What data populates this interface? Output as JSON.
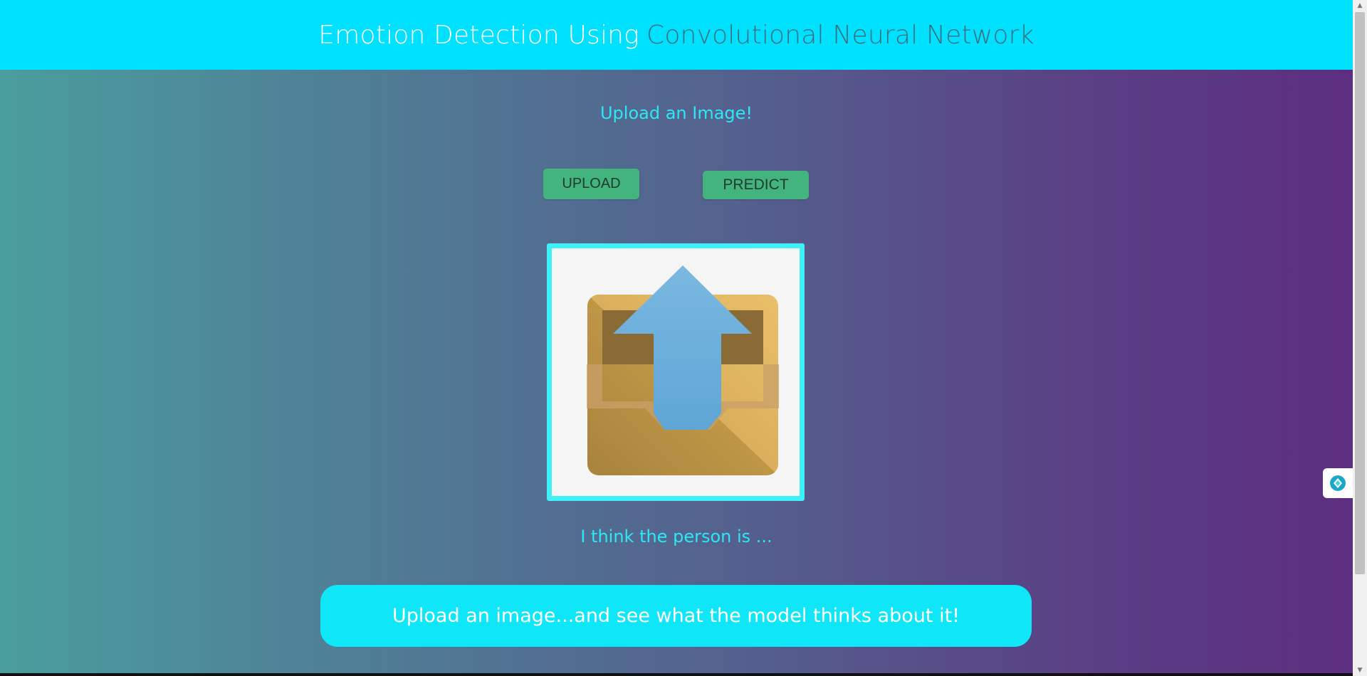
{
  "header": {
    "title_part1": "Emotion Detection Using",
    "title_part2": "Convolutional Neural Network"
  },
  "subtitle": "Upload an Image!",
  "buttons": {
    "upload_label": "UPLOAD",
    "predict_label": "PREDICT"
  },
  "preview": {
    "icon": "upload-tray-icon"
  },
  "result_text": "I think the person is ...",
  "banner_text": "Upload an image...and see what the model thinks about it!",
  "side_widget": {
    "icon": "assistant-diamond-icon"
  },
  "colors": {
    "header_bg": "#00e1ff",
    "accent_text": "#2ee7f4",
    "button_bg": "#44b47f",
    "banner_bg": "#0fe6f8"
  }
}
